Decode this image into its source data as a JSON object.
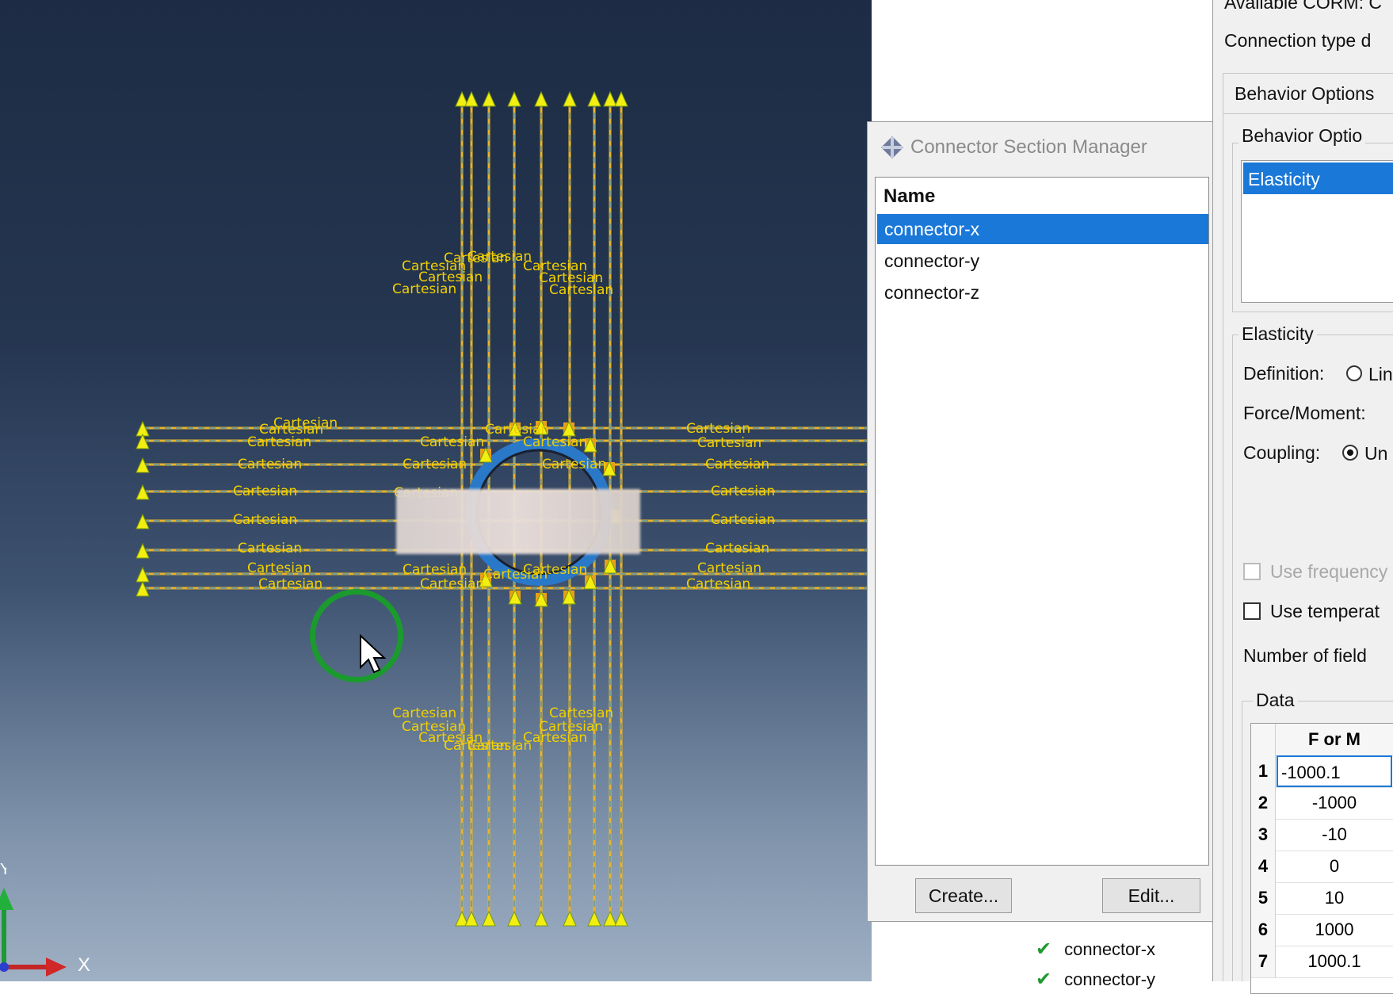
{
  "viewport": {
    "csys_label": "Cartesian",
    "triad": {
      "x_label": "X",
      "y_label": "Y"
    }
  },
  "connector_section_manager": {
    "title": "Connector Section Manager",
    "column_header": "Name",
    "items": [
      {
        "label": "connector-x",
        "selected": true
      },
      {
        "label": "connector-y",
        "selected": false
      },
      {
        "label": "connector-z",
        "selected": false
      }
    ],
    "buttons": {
      "create": "Create...",
      "edit": "Edit..."
    }
  },
  "background_list": {
    "items": [
      "connector-x",
      "connector-y"
    ]
  },
  "edit_section": {
    "available_corm": "Available CORM: C",
    "connection_type": "Connection type d",
    "behavior_tab": "Behavior Options",
    "behavior_group": "Behavior Optio",
    "behavior_items": [
      "Elasticity"
    ],
    "elasticity_group": "Elasticity",
    "definition_label": "Definition:",
    "definition_value": "Lin",
    "force_moment_label": "Force/Moment:",
    "coupling_label": "Coupling:",
    "coupling_value": "Un",
    "use_frequency": "Use frequency",
    "use_temperature": "Use temperat",
    "number_of_field": "Number of field",
    "data_group": "Data",
    "table": {
      "header": "F or M",
      "rows": [
        {
          "n": "1",
          "v": "-1000.1"
        },
        {
          "n": "2",
          "v": "-1000"
        },
        {
          "n": "3",
          "v": "-10"
        },
        {
          "n": "4",
          "v": "0"
        },
        {
          "n": "5",
          "v": "10"
        },
        {
          "n": "6",
          "v": "1000"
        },
        {
          "n": "7",
          "v": "1000.1"
        }
      ]
    }
  }
}
